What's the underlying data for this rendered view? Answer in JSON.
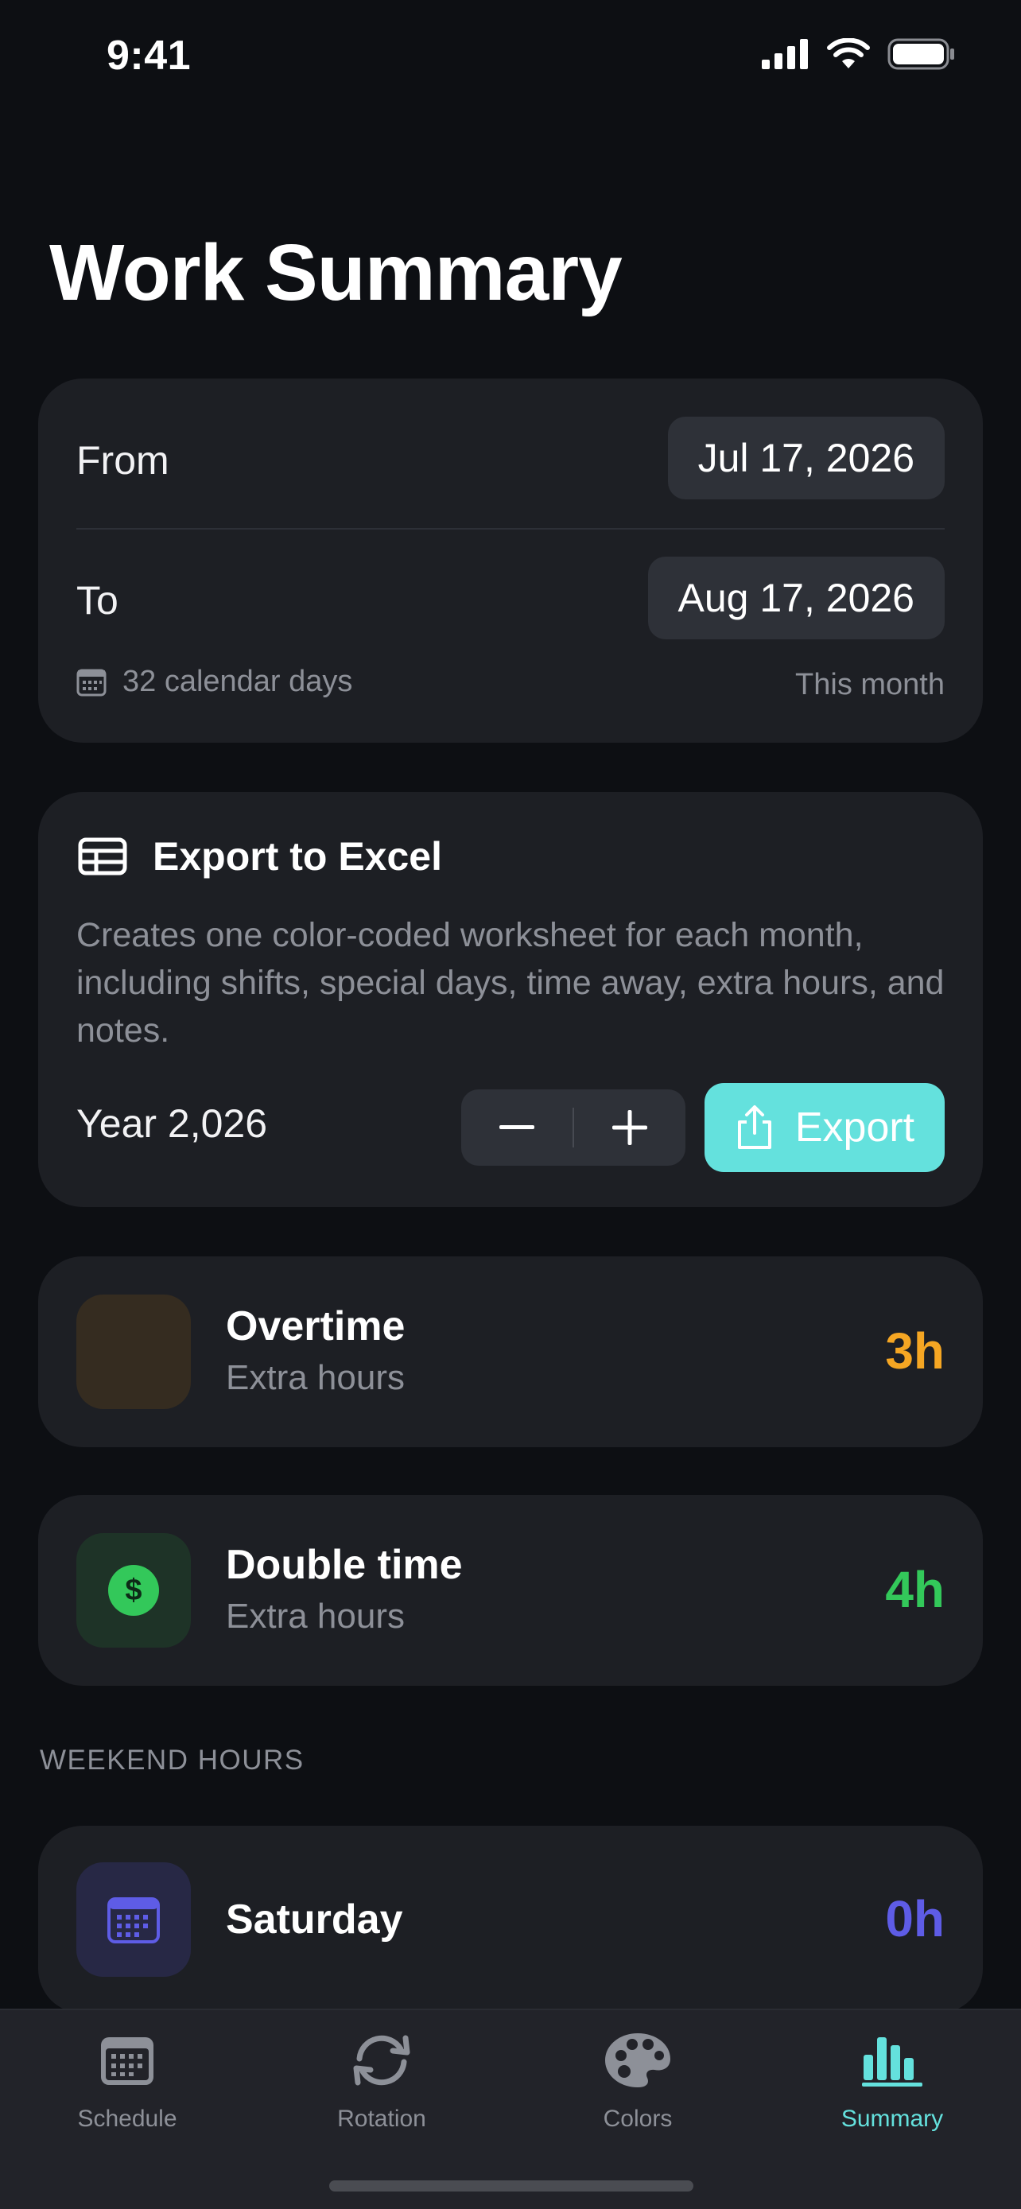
{
  "status": {
    "time": "9:41"
  },
  "page": {
    "title": "Work Summary"
  },
  "range": {
    "from_label": "From",
    "from_value": "Jul 17, 2026",
    "to_label": "To",
    "to_value": "Aug 17, 2026",
    "days_text": "32 calendar days",
    "preset": "This month"
  },
  "export": {
    "title": "Export to Excel",
    "description": "Creates one color-coded worksheet for each month, including shifts, special days, time away, extra hours, and notes.",
    "year_label": "Year 2,026",
    "button_label": "Export"
  },
  "overtime": {
    "title": "Overtime",
    "subtitle": "Extra hours",
    "value": "3h",
    "color": "#f5a623"
  },
  "double_time": {
    "title": "Double time",
    "subtitle": "Extra hours",
    "value": "4h",
    "color": "#33c85a"
  },
  "weekend": {
    "header": "WEEKEND HOURS",
    "saturday": {
      "title": "Saturday",
      "value": "0h",
      "color": "#5e5ce6"
    }
  },
  "tabs": [
    {
      "label": "Schedule",
      "icon": "calendar-icon"
    },
    {
      "label": "Rotation",
      "icon": "rotation-icon"
    },
    {
      "label": "Colors",
      "icon": "palette-icon"
    },
    {
      "label": "Summary",
      "icon": "chart-bars-icon",
      "active": true
    }
  ],
  "accent": "#64e1dd"
}
